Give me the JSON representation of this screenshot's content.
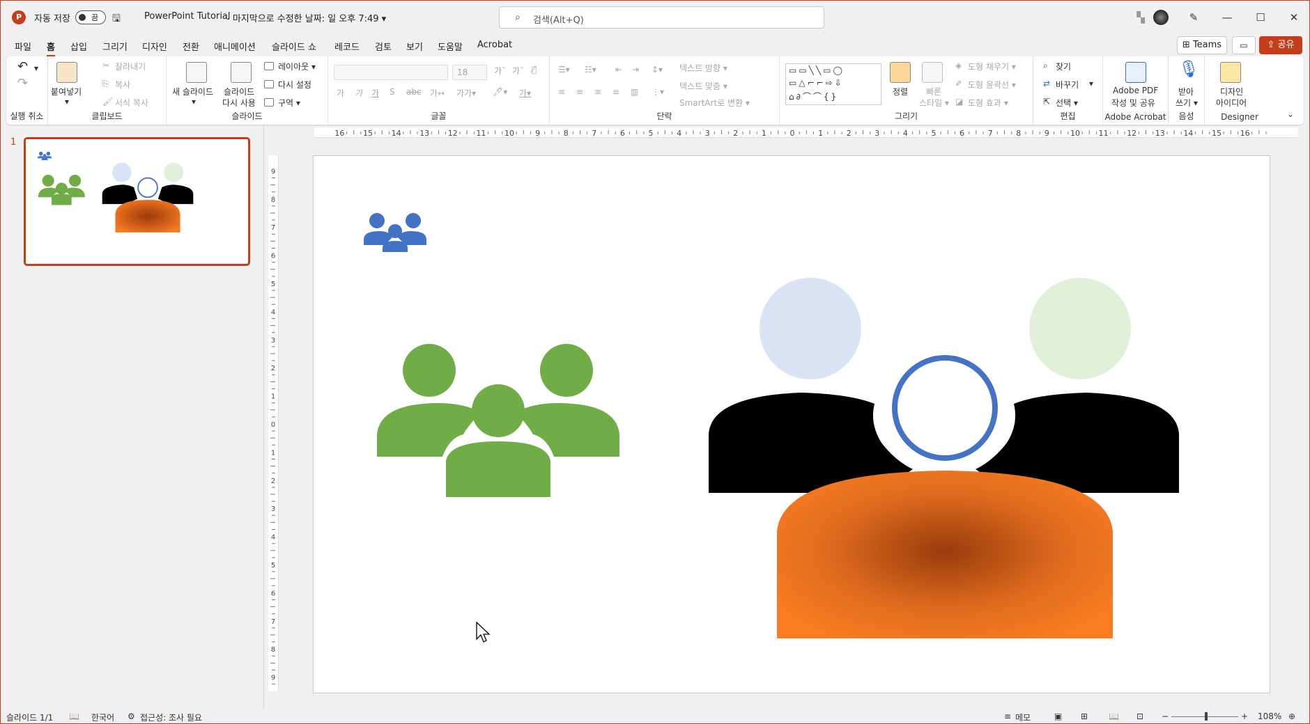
{
  "titlebar": {
    "autosave_label": "자동 저장",
    "toggle_state": "끔",
    "doc_title": "PowerPoint Tutorial",
    "doc_meta": "- 마지막으로 수정한 날짜: 일 오후 7:49 ▾",
    "search_placeholder": "검색(Alt+Q)"
  },
  "menu": {
    "tabs": [
      "파일",
      "홈",
      "삽입",
      "그리기",
      "디자인",
      "전환",
      "애니메이션",
      "슬라이드 쇼",
      "레코드",
      "검토",
      "보기",
      "도움말",
      "Acrobat"
    ],
    "active": "홈",
    "teams": "Teams",
    "share": "공유"
  },
  "ribbon": {
    "undo_group": "실행 취소",
    "clipboard": {
      "label": "클립보드",
      "paste": "붙여넣기",
      "cut": "잘라내기",
      "copy": "복사",
      "format_painter": "서식 복사"
    },
    "slides": {
      "label": "슬라이드",
      "new_slide": "새 슬라이드",
      "reuse_1": "슬라이드",
      "reuse_2": "다시 사용",
      "layout": "레이아웃 ▾",
      "reset": "다시 설정",
      "section": "구역 ▾"
    },
    "font": {
      "label": "글꼴",
      "size": "18"
    },
    "paragraph": {
      "label": "단락",
      "text_direction": "텍스트 방향 ▾",
      "align_text": "텍스트 맞춤 ▾",
      "smartart": "SmartArt로 변환 ▾"
    },
    "drawing": {
      "label": "그리기",
      "arrange": "정렬",
      "quick_styles_1": "빠른",
      "quick_styles_2": "스타일 ▾",
      "fill": "도형 채우기 ▾",
      "outline": "도형 윤곽선 ▾",
      "effects": "도형 효과 ▾"
    },
    "editing": {
      "label": "편집",
      "find": "찾기",
      "replace": "바꾸기",
      "select": "선택 ▾"
    },
    "acrobat": {
      "label": "Adobe Acrobat",
      "pdf_1": "Adobe PDF",
      "pdf_2": "작성 및 공유"
    },
    "voice": {
      "label": "음성",
      "dictate_1": "받아",
      "dictate_2": "쓰기 ▾"
    },
    "designer": {
      "label": "Designer",
      "ideas_1": "디자인",
      "ideas_2": "아이디어"
    }
  },
  "thumbnail": {
    "number": "1"
  },
  "statusbar": {
    "slide": "슬라이드 1/1",
    "language": "한국어",
    "accessibility": "접근성: 조사 필요",
    "notes": "메모",
    "zoom": "108%"
  },
  "colors": {
    "accent": "#c43e1c",
    "blue": "#4472c4",
    "green": "#70ad47",
    "orange": "#e46c0a"
  }
}
